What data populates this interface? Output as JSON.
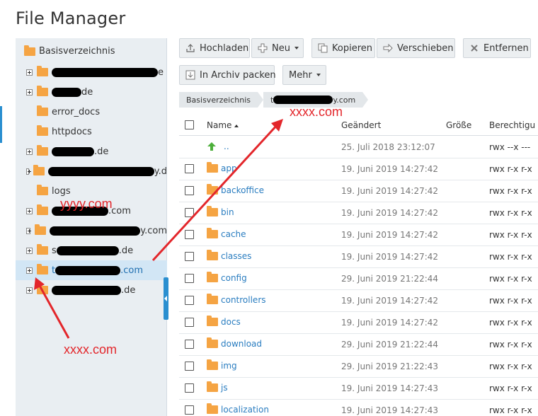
{
  "app": {
    "title": "File Manager"
  },
  "tree": {
    "root": "Basisverzeichnis",
    "items": [
      {
        "prefix": "",
        "suffix": "e",
        "redact_w": 150,
        "expandable": true,
        "selected": false
      },
      {
        "prefix": "",
        "suffix": "de",
        "redact_w": 42,
        "expandable": true,
        "selected": false
      },
      {
        "prefix": "error_docs",
        "suffix": "",
        "redact_w": 0,
        "expandable": false,
        "selected": false
      },
      {
        "prefix": "httpdocs",
        "suffix": "",
        "redact_w": 0,
        "expandable": false,
        "selected": false
      },
      {
        "prefix": "",
        "suffix": ".de",
        "redact_w": 60,
        "expandable": true,
        "selected": false
      },
      {
        "prefix": "",
        "suffix": "y.d",
        "redact_w": 150,
        "expandable": true,
        "selected": false
      },
      {
        "prefix": "logs",
        "suffix": "",
        "redact_w": 0,
        "expandable": false,
        "selected": false
      },
      {
        "prefix": "",
        "suffix": ".com",
        "redact_w": 80,
        "expandable": true,
        "selected": false
      },
      {
        "prefix": "",
        "suffix": "y.com",
        "redact_w": 128,
        "expandable": true,
        "selected": false
      },
      {
        "prefix": "s",
        "suffix": ".de",
        "redact_w": 88,
        "expandable": true,
        "selected": false
      },
      {
        "prefix": "t",
        "suffix": ".com",
        "redact_w": 92,
        "expandable": true,
        "selected": true
      },
      {
        "prefix": "",
        "suffix": ".de",
        "redact_w": 98,
        "expandable": true,
        "selected": false
      }
    ]
  },
  "toolbar": {
    "upload": "Hochladen",
    "new": "Neu",
    "copy": "Kopieren",
    "move": "Verschieben",
    "remove": "Entfernen",
    "archive": "In Archiv packen",
    "more": "Mehr"
  },
  "breadcrumb": {
    "root": "Basisverzeichnis",
    "current_prefix": "t",
    "current_suffix": "y.com"
  },
  "table": {
    "headers": {
      "name": "Name",
      "changed": "Geändert",
      "size": "Größe",
      "perm": "Berechtigu"
    },
    "parent": {
      "name": "..",
      "date": "25. Juli 2018 23:12:07",
      "perm": "rwx --x ---"
    },
    "rows": [
      {
        "name": "app",
        "date": "19. Juni 2019 14:27:42",
        "perm": "rwx r-x r-x"
      },
      {
        "name": "backoffice",
        "date": "19. Juni 2019 14:27:42",
        "perm": "rwx r-x r-x"
      },
      {
        "name": "bin",
        "date": "19. Juni 2019 14:27:42",
        "perm": "rwx r-x r-x"
      },
      {
        "name": "cache",
        "date": "19. Juni 2019 14:27:42",
        "perm": "rwx r-x r-x"
      },
      {
        "name": "classes",
        "date": "19. Juni 2019 14:27:42",
        "perm": "rwx r-x r-x"
      },
      {
        "name": "config",
        "date": "29. Juni 2019 21:22:44",
        "perm": "rwx r-x r-x"
      },
      {
        "name": "controllers",
        "date": "19. Juni 2019 14:27:42",
        "perm": "rwx r-x r-x"
      },
      {
        "name": "docs",
        "date": "19. Juni 2019 14:27:42",
        "perm": "rwx r-x r-x"
      },
      {
        "name": "download",
        "date": "29. Juni 2019 21:22:44",
        "perm": "rwx r-x r-x"
      },
      {
        "name": "img",
        "date": "29. Juni 2019 21:22:43",
        "perm": "rwx r-x r-x"
      },
      {
        "name": "js",
        "date": "19. Juni 2019 14:27:43",
        "perm": "rwx r-x r-x"
      },
      {
        "name": "localization",
        "date": "19. Juni 2019 14:27:43",
        "perm": "rwx r-x r-x"
      }
    ]
  },
  "annotations": {
    "top": "xxxx.com",
    "middle": "yyyy.com",
    "bottom": "xxxx.com",
    "color": "#e3262b"
  },
  "colors": {
    "accent": "#2a8fd0",
    "folder": "#f5a443",
    "link": "#2a7dc0"
  }
}
